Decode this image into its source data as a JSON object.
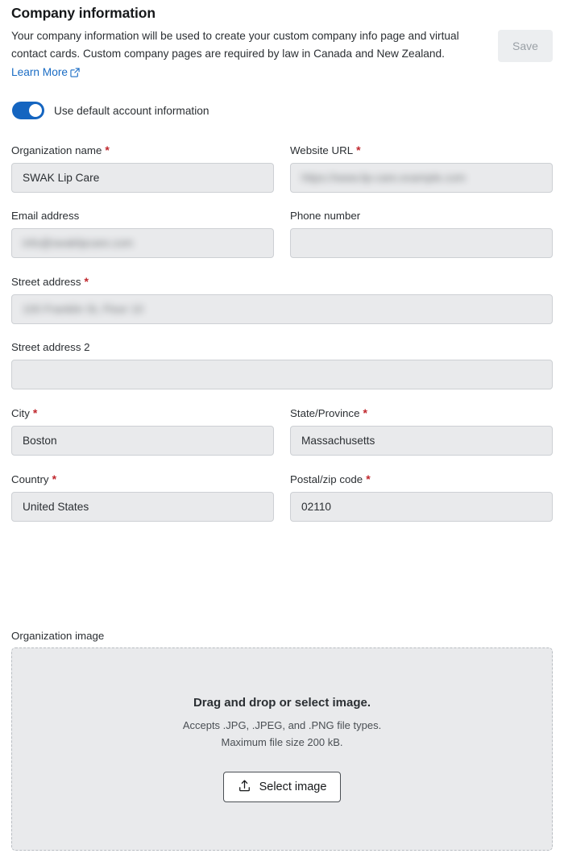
{
  "header": {
    "title": "Company information",
    "description_before_link": "Your company information will be used to create your custom company info page and virtual contact cards. Custom company pages are required by law in Canada and New Zealand. ",
    "learn_more_label": "Learn More",
    "learn_more_icon": "external-link-icon",
    "save_label": "Save"
  },
  "toggle": {
    "label": "Use default account information",
    "state": "on",
    "accent_color": "#1565c0"
  },
  "form": {
    "organization_name": {
      "label": "Organization name",
      "required": true,
      "value": "SWAK Lip Care",
      "redacted": false
    },
    "website_url": {
      "label": "Website URL",
      "required": true,
      "value": "https://www.lip-care.example.com",
      "redacted": true
    },
    "email_address": {
      "label": "Email address",
      "required": false,
      "value": "info@swaklipcare.com",
      "redacted": true
    },
    "phone_number": {
      "label": "Phone number",
      "required": false,
      "value": "",
      "redacted": false
    },
    "street_address": {
      "label": "Street address",
      "required": true,
      "value": "100 Franklin St, Floor 10",
      "redacted": true
    },
    "street_address_2": {
      "label": "Street address 2",
      "required": false,
      "value": "",
      "redacted": false
    },
    "city": {
      "label": "City",
      "required": true,
      "value": "Boston",
      "redacted": false
    },
    "state_province": {
      "label": "State/Province",
      "required": true,
      "value": "Massachusetts",
      "redacted": false
    },
    "country": {
      "label": "Country",
      "required": true,
      "value": "United States",
      "redacted": false
    },
    "postal_code": {
      "label": "Postal/zip code",
      "required": true,
      "value": "02110",
      "redacted": false
    },
    "required_marker": "*",
    "required_color": "#c0272d"
  },
  "organization_image": {
    "label": "Organization image",
    "dropzone_title": "Drag and drop or select image.",
    "accepts_text": "Accepts .JPG, .JPEG, and .PNG file types.",
    "max_size_text": "Maximum file size 200 kB.",
    "select_button_label": "Select image",
    "select_button_icon": "upload-icon"
  }
}
